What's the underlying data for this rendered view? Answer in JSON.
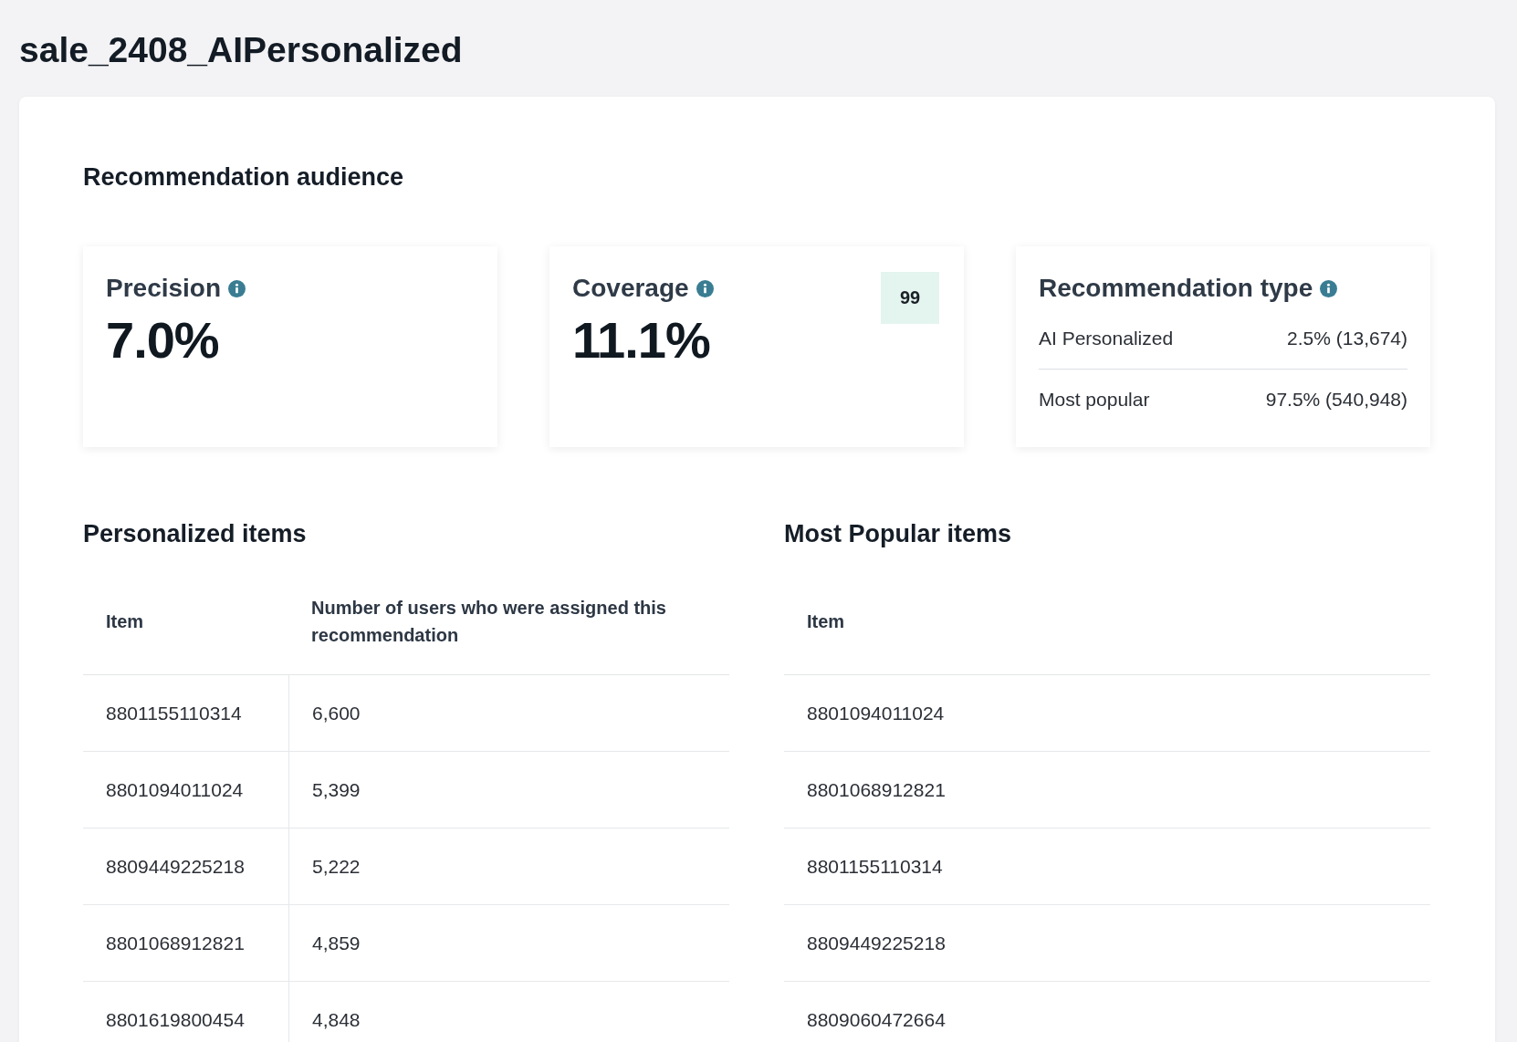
{
  "page": {
    "title": "sale_2408_AIPersonalized"
  },
  "audience": {
    "title": "Recommendation audience",
    "metrics": [
      {
        "kind": "stat",
        "label": "Precision",
        "value": "7.0%"
      },
      {
        "kind": "stat",
        "label": "Coverage",
        "value": "11.1%",
        "badge": "99"
      },
      {
        "kind": "breakdown",
        "label": "Recommendation type",
        "rows": [
          {
            "name": "AI Personalized",
            "value": "2.5% (13,674)"
          },
          {
            "name": "Most popular",
            "value": "97.5% (540,948)"
          }
        ]
      }
    ]
  },
  "tables": [
    {
      "title": "Personalized items",
      "columns": [
        "Item",
        "Number of users who were assigned this recommendation"
      ],
      "rows": [
        [
          "8801155110314",
          "6,600"
        ],
        [
          "8801094011024",
          "5,399"
        ],
        [
          "8809449225218",
          "5,222"
        ],
        [
          "8801068912821",
          "4,859"
        ],
        [
          "8801619800454",
          "4,848"
        ]
      ]
    },
    {
      "title": "Most Popular items",
      "columns": [
        "Item"
      ],
      "rows": [
        [
          "8801094011024"
        ],
        [
          "8801068912821"
        ],
        [
          "8801155110314"
        ],
        [
          "8809449225218"
        ],
        [
          "8809060472664"
        ]
      ]
    }
  ]
}
